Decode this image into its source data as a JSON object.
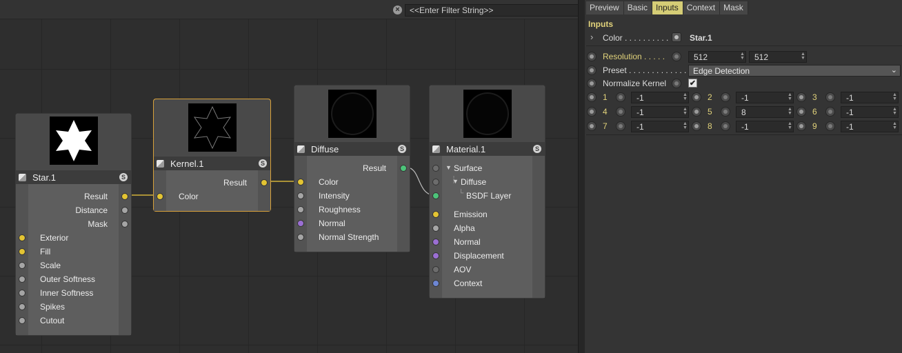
{
  "editor": {
    "filter_placeholder": "<<Enter Filter String>>"
  },
  "nodes": {
    "star": {
      "title": "Star.1",
      "badge": "S",
      "outputs": [
        "Result",
        "Distance",
        "Mask"
      ],
      "inputs": [
        "Exterior",
        "Fill",
        "Scale",
        "Outer Softness",
        "Inner Softness",
        "Spikes",
        "Cutout"
      ]
    },
    "kernel": {
      "title": "Kernel.1",
      "badge": "S",
      "output": "Result",
      "input": "Color"
    },
    "diffuse": {
      "title": "Diffuse",
      "badge": "S",
      "output": "Result",
      "inputs": [
        "Color",
        "Intensity",
        "Roughness",
        "Normal",
        "Normal Strength"
      ]
    },
    "material": {
      "title": "Material.1",
      "badge": "S",
      "tree": [
        "Surface",
        "Diffuse",
        "BSDF Layer"
      ],
      "inputs": [
        "Emission",
        "Alpha",
        "Normal",
        "Displacement",
        "AOV",
        "Context"
      ]
    }
  },
  "panel": {
    "tabs": [
      "Preview",
      "Basic",
      "Inputs",
      "Context",
      "Mask"
    ],
    "active_tab": "Inputs",
    "section_title": "Inputs",
    "color": {
      "label": "Color . . . . . . . . . .",
      "linked": "Star.1"
    },
    "resolution": {
      "label": "Resolution . . . . .",
      "x": "512",
      "y": "512"
    },
    "preset": {
      "label": "Preset . . . . . . . . . . . . . .",
      "value": "Edge Detection"
    },
    "normalize": {
      "label": "Normalize Kernel",
      "checked": "✔"
    },
    "kernel_cells": [
      {
        "index": "1",
        "value": "-1"
      },
      {
        "index": "2",
        "value": "-1"
      },
      {
        "index": "3",
        "value": "-1"
      },
      {
        "index": "4",
        "value": "-1"
      },
      {
        "index": "5",
        "value": "8"
      },
      {
        "index": "6",
        "value": "-1"
      },
      {
        "index": "7",
        "value": "-1"
      },
      {
        "index": "8",
        "value": "-1"
      },
      {
        "index": "9",
        "value": "-1"
      }
    ]
  }
}
